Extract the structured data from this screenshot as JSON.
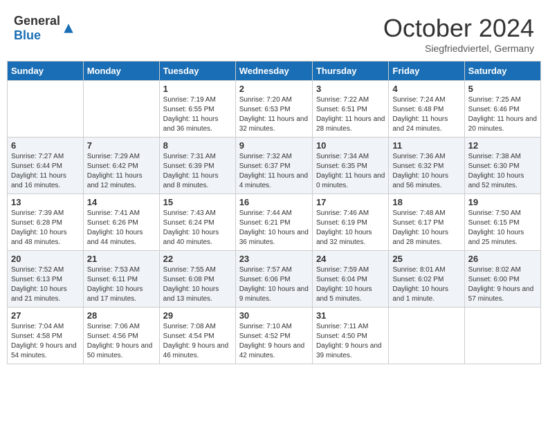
{
  "header": {
    "logo_general": "General",
    "logo_blue": "Blue",
    "month_title": "October 2024",
    "subtitle": "Siegfriedviertel, Germany"
  },
  "days_of_week": [
    "Sunday",
    "Monday",
    "Tuesday",
    "Wednesday",
    "Thursday",
    "Friday",
    "Saturday"
  ],
  "weeks": [
    [
      {
        "day": "",
        "detail": ""
      },
      {
        "day": "",
        "detail": ""
      },
      {
        "day": "1",
        "detail": "Sunrise: 7:19 AM\nSunset: 6:55 PM\nDaylight: 11 hours\nand 36 minutes."
      },
      {
        "day": "2",
        "detail": "Sunrise: 7:20 AM\nSunset: 6:53 PM\nDaylight: 11 hours\nand 32 minutes."
      },
      {
        "day": "3",
        "detail": "Sunrise: 7:22 AM\nSunset: 6:51 PM\nDaylight: 11 hours\nand 28 minutes."
      },
      {
        "day": "4",
        "detail": "Sunrise: 7:24 AM\nSunset: 6:48 PM\nDaylight: 11 hours\nand 24 minutes."
      },
      {
        "day": "5",
        "detail": "Sunrise: 7:25 AM\nSunset: 6:46 PM\nDaylight: 11 hours\nand 20 minutes."
      }
    ],
    [
      {
        "day": "6",
        "detail": "Sunrise: 7:27 AM\nSunset: 6:44 PM\nDaylight: 11 hours\nand 16 minutes."
      },
      {
        "day": "7",
        "detail": "Sunrise: 7:29 AM\nSunset: 6:42 PM\nDaylight: 11 hours\nand 12 minutes."
      },
      {
        "day": "8",
        "detail": "Sunrise: 7:31 AM\nSunset: 6:39 PM\nDaylight: 11 hours\nand 8 minutes."
      },
      {
        "day": "9",
        "detail": "Sunrise: 7:32 AM\nSunset: 6:37 PM\nDaylight: 11 hours\nand 4 minutes."
      },
      {
        "day": "10",
        "detail": "Sunrise: 7:34 AM\nSunset: 6:35 PM\nDaylight: 11 hours\nand 0 minutes."
      },
      {
        "day": "11",
        "detail": "Sunrise: 7:36 AM\nSunset: 6:32 PM\nDaylight: 10 hours\nand 56 minutes."
      },
      {
        "day": "12",
        "detail": "Sunrise: 7:38 AM\nSunset: 6:30 PM\nDaylight: 10 hours\nand 52 minutes."
      }
    ],
    [
      {
        "day": "13",
        "detail": "Sunrise: 7:39 AM\nSunset: 6:28 PM\nDaylight: 10 hours\nand 48 minutes."
      },
      {
        "day": "14",
        "detail": "Sunrise: 7:41 AM\nSunset: 6:26 PM\nDaylight: 10 hours\nand 44 minutes."
      },
      {
        "day": "15",
        "detail": "Sunrise: 7:43 AM\nSunset: 6:24 PM\nDaylight: 10 hours\nand 40 minutes."
      },
      {
        "day": "16",
        "detail": "Sunrise: 7:44 AM\nSunset: 6:21 PM\nDaylight: 10 hours\nand 36 minutes."
      },
      {
        "day": "17",
        "detail": "Sunrise: 7:46 AM\nSunset: 6:19 PM\nDaylight: 10 hours\nand 32 minutes."
      },
      {
        "day": "18",
        "detail": "Sunrise: 7:48 AM\nSunset: 6:17 PM\nDaylight: 10 hours\nand 28 minutes."
      },
      {
        "day": "19",
        "detail": "Sunrise: 7:50 AM\nSunset: 6:15 PM\nDaylight: 10 hours\nand 25 minutes."
      }
    ],
    [
      {
        "day": "20",
        "detail": "Sunrise: 7:52 AM\nSunset: 6:13 PM\nDaylight: 10 hours\nand 21 minutes."
      },
      {
        "day": "21",
        "detail": "Sunrise: 7:53 AM\nSunset: 6:11 PM\nDaylight: 10 hours\nand 17 minutes."
      },
      {
        "day": "22",
        "detail": "Sunrise: 7:55 AM\nSunset: 6:08 PM\nDaylight: 10 hours\nand 13 minutes."
      },
      {
        "day": "23",
        "detail": "Sunrise: 7:57 AM\nSunset: 6:06 PM\nDaylight: 10 hours\nand 9 minutes."
      },
      {
        "day": "24",
        "detail": "Sunrise: 7:59 AM\nSunset: 6:04 PM\nDaylight: 10 hours\nand 5 minutes."
      },
      {
        "day": "25",
        "detail": "Sunrise: 8:01 AM\nSunset: 6:02 PM\nDaylight: 10 hours\nand 1 minute."
      },
      {
        "day": "26",
        "detail": "Sunrise: 8:02 AM\nSunset: 6:00 PM\nDaylight: 9 hours\nand 57 minutes."
      }
    ],
    [
      {
        "day": "27",
        "detail": "Sunrise: 7:04 AM\nSunset: 4:58 PM\nDaylight: 9 hours\nand 54 minutes."
      },
      {
        "day": "28",
        "detail": "Sunrise: 7:06 AM\nSunset: 4:56 PM\nDaylight: 9 hours\nand 50 minutes."
      },
      {
        "day": "29",
        "detail": "Sunrise: 7:08 AM\nSunset: 4:54 PM\nDaylight: 9 hours\nand 46 minutes."
      },
      {
        "day": "30",
        "detail": "Sunrise: 7:10 AM\nSunset: 4:52 PM\nDaylight: 9 hours\nand 42 minutes."
      },
      {
        "day": "31",
        "detail": "Sunrise: 7:11 AM\nSunset: 4:50 PM\nDaylight: 9 hours\nand 39 minutes."
      },
      {
        "day": "",
        "detail": ""
      },
      {
        "day": "",
        "detail": ""
      }
    ]
  ]
}
